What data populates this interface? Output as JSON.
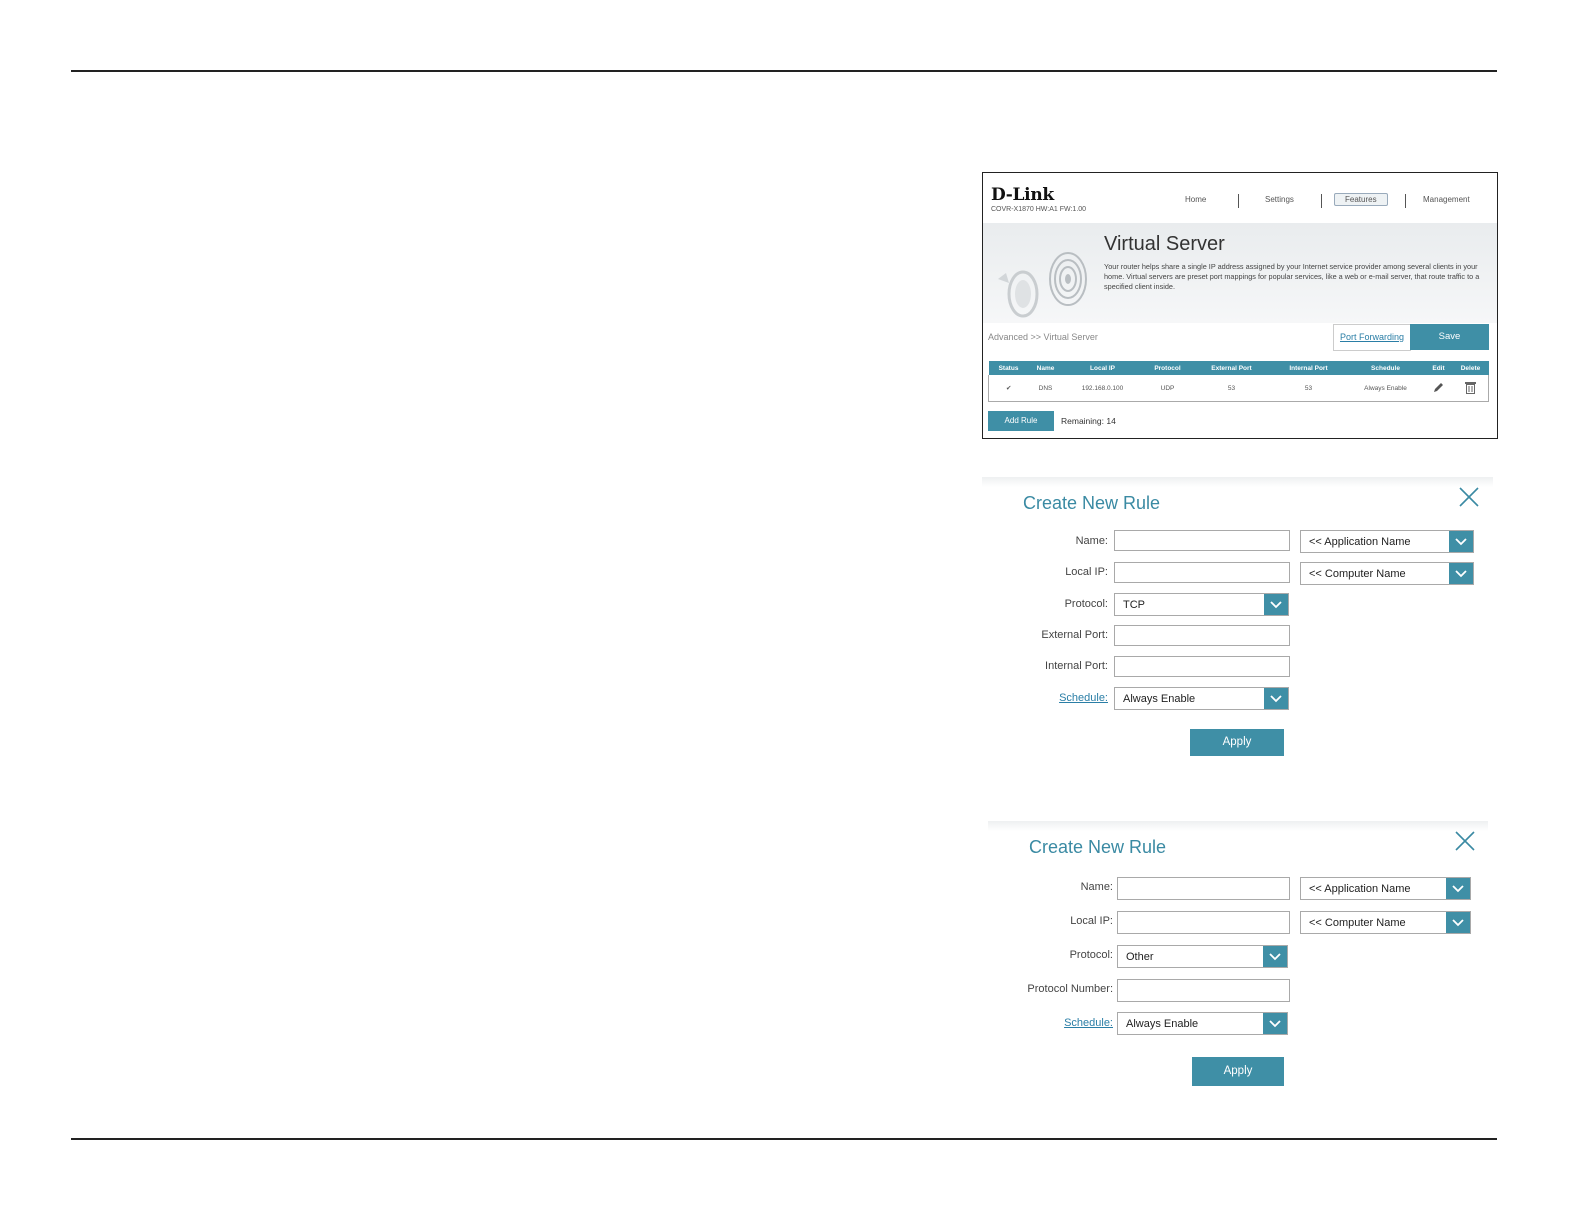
{
  "virtual_server": {
    "logo": "D-Link",
    "model": "COVR-X1870 HW:A1 FW:1.00",
    "nav": [
      "Home",
      "Settings",
      "Features",
      "Management"
    ],
    "active_nav": "Features",
    "title": "Virtual Server",
    "description": "Your router helps share a single IP address assigned by your Internet service provider among several clients in your home. Virtual servers are preset port mappings for popular services, like a web or e-mail server, that route traffic to a specified client inside.",
    "breadcrumb": "Advanced >> Virtual Server",
    "port_forwarding_link": "Port Forwarding",
    "save_label": "Save",
    "table": {
      "headers": [
        "Status",
        "Name",
        "Local IP",
        "Protocol",
        "External Port",
        "Internal Port",
        "Schedule",
        "Edit",
        "Delete"
      ],
      "rows": [
        {
          "status": "✔",
          "name": "DNS",
          "local_ip": "192.168.0.100",
          "protocol": "UDP",
          "external_port": "53",
          "internal_port": "53",
          "schedule": "Always Enable"
        }
      ]
    },
    "add_rule_label": "Add Rule",
    "remaining": "Remaining: 14"
  },
  "rule_tcp": {
    "title": "Create New Rule",
    "labels": {
      "name": "Name:",
      "local_ip": "Local IP:",
      "protocol": "Protocol:",
      "external_port": "External Port:",
      "internal_port": "Internal Port:",
      "schedule": "Schedule:"
    },
    "application_name": "<< Application Name",
    "computer_name": "<< Computer Name",
    "protocol_value": "TCP",
    "schedule_value": "Always Enable",
    "apply_label": "Apply"
  },
  "rule_other": {
    "title": "Create New Rule",
    "labels": {
      "name": "Name:",
      "local_ip": "Local IP:",
      "protocol": "Protocol:",
      "protocol_number": "Protocol Number:",
      "schedule": "Schedule:"
    },
    "application_name": "<< Application Name",
    "computer_name": "<< Computer Name",
    "protocol_value": "Other",
    "schedule_value": "Always Enable",
    "apply_label": "Apply"
  },
  "colors": {
    "accent": "#3f8fa6",
    "title_blue": "#3a8aa3",
    "link": "#2a7ea6"
  }
}
